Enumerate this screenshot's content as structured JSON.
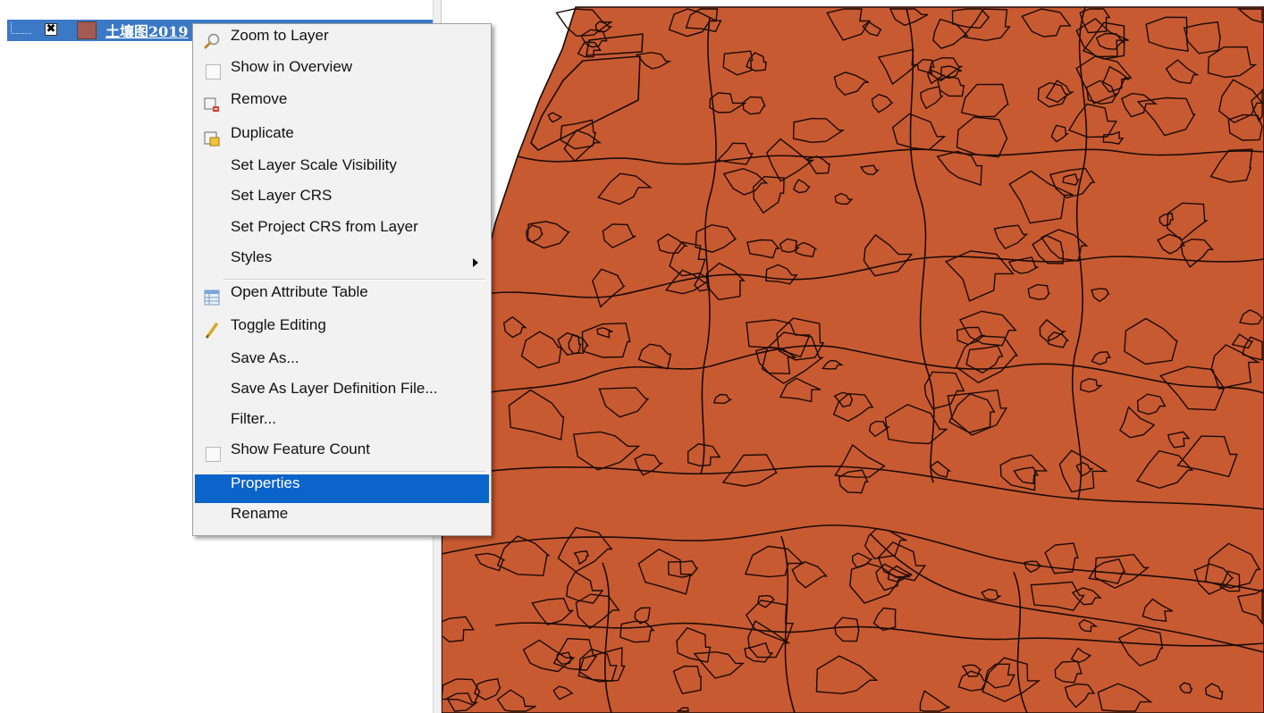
{
  "layer": {
    "name": "土壤图2019",
    "checked_glyph": "✖",
    "swatch_color": "#a35a50"
  },
  "map": {
    "fill_color": "#c85a31",
    "line_color": "#1a0a05"
  },
  "context_menu": {
    "items": [
      {
        "label": "Zoom to Layer",
        "icon": "magnifier-icon"
      },
      {
        "label": "Show in Overview",
        "icon": "checkbox-icon"
      },
      {
        "label": "Remove",
        "icon": "remove-layer-icon"
      },
      {
        "label": "Duplicate",
        "icon": "duplicate-layer-icon"
      },
      {
        "label": "Set Layer Scale Visibility"
      },
      {
        "label": "Set Layer CRS"
      },
      {
        "label": "Set Project CRS from Layer"
      },
      {
        "label": "Styles",
        "submenu": true
      },
      {
        "label": "Open Attribute Table",
        "icon": "table-icon"
      },
      {
        "label": "Toggle Editing",
        "icon": "pencil-icon"
      },
      {
        "label": "Save As..."
      },
      {
        "label": "Save As Layer Definition File..."
      },
      {
        "label": "Filter..."
      },
      {
        "label": "Show Feature Count",
        "icon": "checkbox-icon"
      },
      {
        "label": "Properties",
        "highlighted": true
      },
      {
        "label": "Rename"
      }
    ]
  },
  "colors": {
    "selection": "#3b79c6",
    "menu_highlight": "#0a64c9"
  }
}
